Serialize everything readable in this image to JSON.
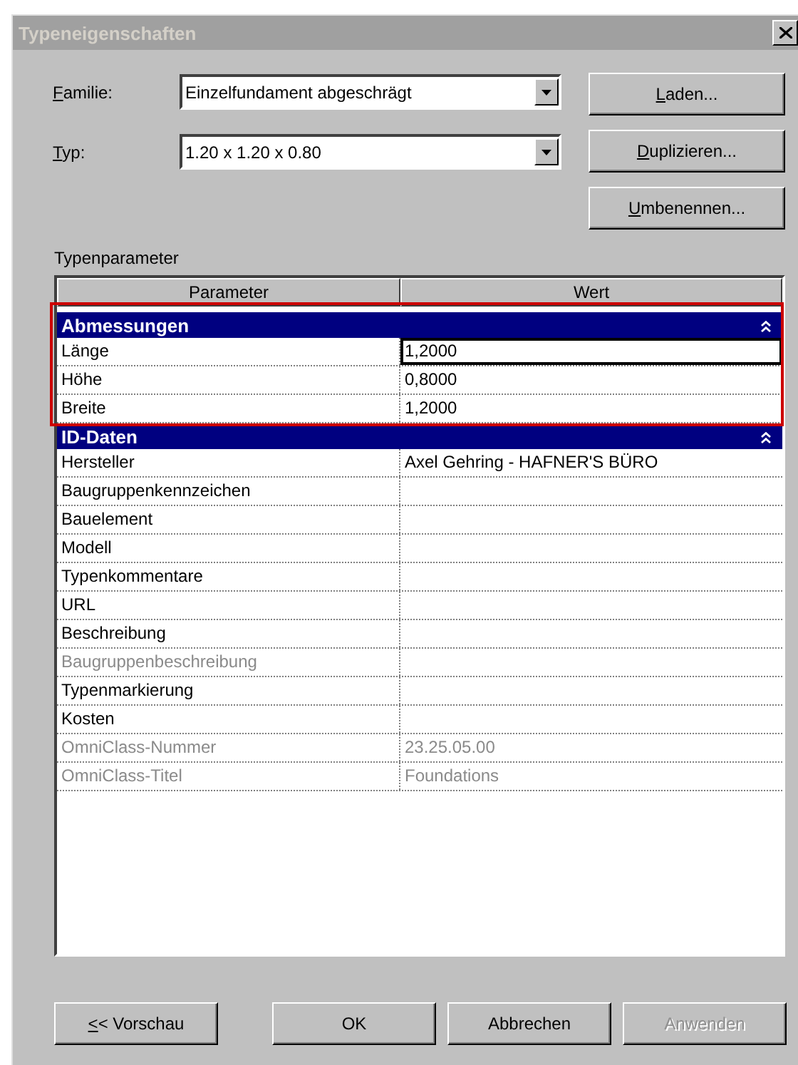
{
  "window": {
    "title": "Typeneigenschaften",
    "active": false
  },
  "fields": [
    {
      "label_key": "F",
      "label_rest": "amilie:",
      "value": "Einzelfundament abgeschrägt"
    },
    {
      "label_key": "T",
      "label_rest": "yp:",
      "value": "1.20 x 1.20 x 0.80"
    }
  ],
  "side_buttons": [
    {
      "key": "L",
      "rest": "aden..."
    },
    {
      "key": "D",
      "rest": "uplizieren..."
    },
    {
      "key": "U",
      "rest": "mbenennen..."
    }
  ],
  "section_label": "Typenparameter",
  "table": {
    "columns": [
      "Parameter",
      "Wert"
    ],
    "groups": [
      {
        "title": "Abmessungen",
        "expanded": true,
        "highlighted": true,
        "rows": [
          {
            "name": "Länge",
            "value": "1,2000",
            "disabled": false,
            "selected": true
          },
          {
            "name": "Höhe",
            "value": "0,8000",
            "disabled": false,
            "selected": false
          },
          {
            "name": "Breite",
            "value": "1,2000",
            "disabled": false,
            "selected": false
          }
        ]
      },
      {
        "title": "ID-Daten",
        "expanded": true,
        "highlighted": false,
        "rows": [
          {
            "name": "Hersteller",
            "value": "Axel Gehring - HAFNER'S BÜRO",
            "disabled": false,
            "selected": false
          },
          {
            "name": "Baugruppenkennzeichen",
            "disabled": false,
            "selected": false
          },
          {
            "name": "Bauelement",
            "disabled": false,
            "selected": false
          },
          {
            "name": "Modell",
            "disabled": false,
            "selected": false
          },
          {
            "name": "Typenkommentare",
            "disabled": false,
            "selected": false
          },
          {
            "name": "URL",
            "disabled": false,
            "selected": false
          },
          {
            "name": "Beschreibung",
            "disabled": false,
            "selected": false
          },
          {
            "name": "Baugruppenbeschreibung",
            "disabled": true,
            "selected": false
          },
          {
            "name": "Typenmarkierung",
            "disabled": false,
            "selected": false
          },
          {
            "name": "Kosten",
            "disabled": false,
            "selected": false
          },
          {
            "name": "OmniClass-Nummer",
            "value": "23.25.05.00",
            "disabled": true,
            "selected": false
          },
          {
            "name": "OmniClass-Titel",
            "value": "Foundations",
            "disabled": true,
            "selected": false
          }
        ]
      }
    ]
  },
  "buttons": [
    {
      "key": "<",
      "rest": "< Vorschau",
      "disabled": false
    },
    {
      "label": "OK",
      "disabled": false
    },
    {
      "label": "Abbrechen",
      "disabled": false
    },
    {
      "label": "Anwenden",
      "disabled": true
    }
  ]
}
